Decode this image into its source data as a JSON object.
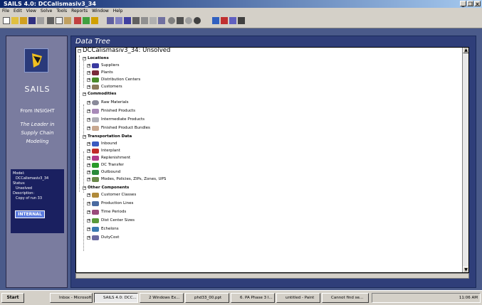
{
  "window": {
    "title": "SAILS 4.0: DCCalismasiv3_34"
  },
  "menu": [
    "File",
    "Edit",
    "View",
    "Solve",
    "Tools",
    "Reports",
    "Window",
    "Help"
  ],
  "left_panel": {
    "product": "SAILS",
    "from": "From INSIGHT",
    "tagline": [
      "The Leader in",
      "Supply Chain",
      "Modeling"
    ],
    "model_label": "Model:",
    "model_name": "DCCalismasiv3_34",
    "status_label": "Status:",
    "status_value": "Unsolved",
    "description_label": "Description:",
    "description_value": "Copy of run 33",
    "internal_button": "INTERNAL"
  },
  "tree": {
    "header": "Data Tree",
    "root": "DCCalismasiv3_34: Unsolved",
    "sections": [
      {
        "label": "Locations",
        "items": [
          "Suppliers",
          "Plants",
          "Distribution Centers",
          "Customers"
        ]
      },
      {
        "label": "Commodities",
        "items": [
          "Raw Materials",
          "Finished Products",
          "Intermediate Products",
          "Finished Product Bundles"
        ]
      },
      {
        "label": "Transportation Data",
        "items": [
          "Inbound",
          "Interplant",
          "Replenishment",
          "DC Transfer",
          "Outbound",
          "Modes, Policies, ZIPs, Zones, UPS"
        ]
      },
      {
        "label": "Other Components",
        "items": [
          "Customer Classes",
          "Production Lines",
          "Time Periods",
          "Dist Center Sizes",
          "Echelons",
          "DutyCost"
        ]
      }
    ]
  },
  "taskbar": {
    "start": "Start",
    "tasks": [
      "Inbox - Microsoft ...",
      "SAILS 4.0: DCC...",
      "2 Windows Ex...",
      "phd33_00.ppt",
      "6. PA Phase 3 I...",
      "untitled - Paint",
      "Cannot find se..."
    ],
    "clock": "11:06 AM"
  },
  "colors": {
    "workspace": "#4a5a8a",
    "left_panel": "#7a7c9f",
    "right_panel": "#2f3e79",
    "model_box": "#1a2060",
    "internal_button": "#5a7adf",
    "title_bar": "#0a246a"
  },
  "icons": {
    "Suppliers": "#3a3aa0",
    "Plants": "#7a2a3a",
    "Distribution Centers": "#4a8a2a",
    "Customers": "#8a7a5a",
    "Raw Materials": "#8a8a9a",
    "Finished Products": "#a88ab8",
    "Intermediate Products": "#b0b0b8",
    "Finished Product Bundles": "#c8a890",
    "Inbound": "#3a5ac0",
    "Interplant": "#c02a2a",
    "Replenishment": "#b03a8a",
    "DC Transfer": "#2a9a2a",
    "Outbound": "#2a8a3a",
    "Modes, Policies, ZIPs, Zones, UPS": "#6a8a4a",
    "Customer Classes": "#b08a3a",
    "Production Lines": "#4a6aa0",
    "Time Periods": "#9a4a7a",
    "Dist Center Sizes": "#5a9a3a",
    "Echelons": "#3a7ab0",
    "DutyCost": "#6a6aa0"
  }
}
